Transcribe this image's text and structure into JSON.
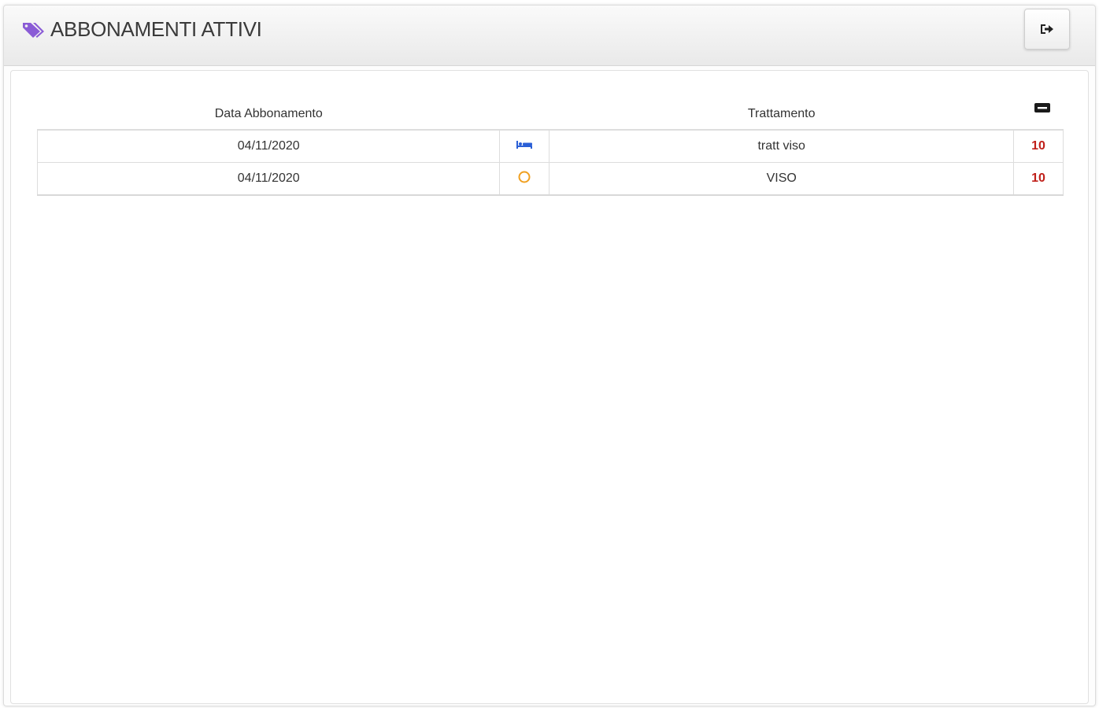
{
  "header": {
    "title": "ABBONAMENTI ATTIVI",
    "title_icon": "tags-icon",
    "exit_icon": "sign-out-icon"
  },
  "table": {
    "columns": {
      "date": "Data Abbonamento",
      "treatment": "Trattamento",
      "count_icon": "minus-square-icon"
    },
    "rows": [
      {
        "date": "04/11/2020",
        "icon": "bed-icon",
        "icon_color": "#2a5fd6",
        "treatment": "tratt viso",
        "count": "10"
      },
      {
        "date": "04/11/2020",
        "icon": "circle-icon",
        "icon_color": "#f0a020",
        "treatment": "VISO",
        "count": "10"
      }
    ]
  },
  "colors": {
    "accent_purple": "#8a5bd6",
    "count_red": "#c0201a"
  }
}
